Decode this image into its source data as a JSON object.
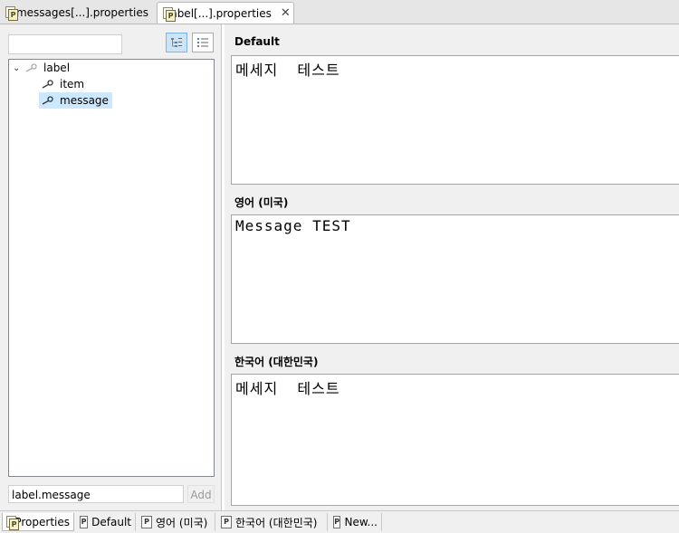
{
  "editor_tabs": [
    {
      "label": "messages[...].properties",
      "icon": "properties-file-icon"
    },
    {
      "label": "label[...].properties",
      "icon": "properties-file-icon",
      "active": true
    }
  ],
  "left": {
    "filter_value": "",
    "tree": [
      {
        "label": "label",
        "level": 0,
        "expanded": true
      },
      {
        "label": "item",
        "level": 1
      },
      {
        "label": "message",
        "level": 1,
        "selected": true
      }
    ],
    "add_input_value": "label.message",
    "add_label": "Add"
  },
  "sections": [
    {
      "label": "Default",
      "value": "메세지  테스트"
    },
    {
      "label": "영어 (미국)",
      "value": "Message TEST"
    },
    {
      "label": "한국어 (대한민국)",
      "value": "메세지  테스트"
    }
  ],
  "bottom_tabs": [
    {
      "label": "Properties",
      "active": true
    },
    {
      "label": "Default"
    },
    {
      "label": "영어 (미국)"
    },
    {
      "label": "한국어 (대한민국)"
    },
    {
      "label": "New..."
    }
  ],
  "colors": {
    "selection": "#cce8ff",
    "accent_button": "#cce4f7"
  }
}
